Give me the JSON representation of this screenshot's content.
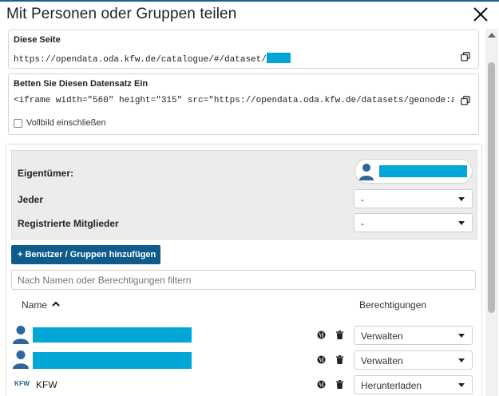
{
  "dialog": {
    "title": "Mit Personen oder Gruppen teilen"
  },
  "this_page": {
    "title": "Diese Seite",
    "url": "https://opendata.oda.kfw.de/catalogue/#/dataset/"
  },
  "embed": {
    "title": "Betten Sie Diesen Datensatz Ein",
    "code": "<iframe width=\"560\" height=\"315\" src=\"https://opendata.oda.kfw.de/datasets/geonode:acled_d…",
    "fullscreen_label": "Vollbild einschließen"
  },
  "permissions": {
    "owner_label": "Eigentümer:",
    "everyone_label": "Jeder",
    "everyone_value": "-",
    "registered_label": "Registrierte Mitglieder",
    "registered_value": "-"
  },
  "add_button": {
    "label": "Benutzer / Gruppen hinzufügen"
  },
  "filter": {
    "placeholder": "Nach Namen oder Berechtigungen filtern"
  },
  "table": {
    "col_name": "Name",
    "col_permissions": "Berechtigungen",
    "rows": [
      {
        "name": "",
        "permission": "Verwalten",
        "avatar": "user-avatar-icon"
      },
      {
        "name": "",
        "permission": "Verwalten",
        "avatar": "user-avatar-icon"
      },
      {
        "name": "KFW",
        "permission": "Herunterladen",
        "avatar": "kfw-logo-icon"
      }
    ]
  },
  "colors": {
    "accent": "#0f5c8c",
    "redaction": "#00a6d6",
    "avatar": "#2f6699"
  }
}
